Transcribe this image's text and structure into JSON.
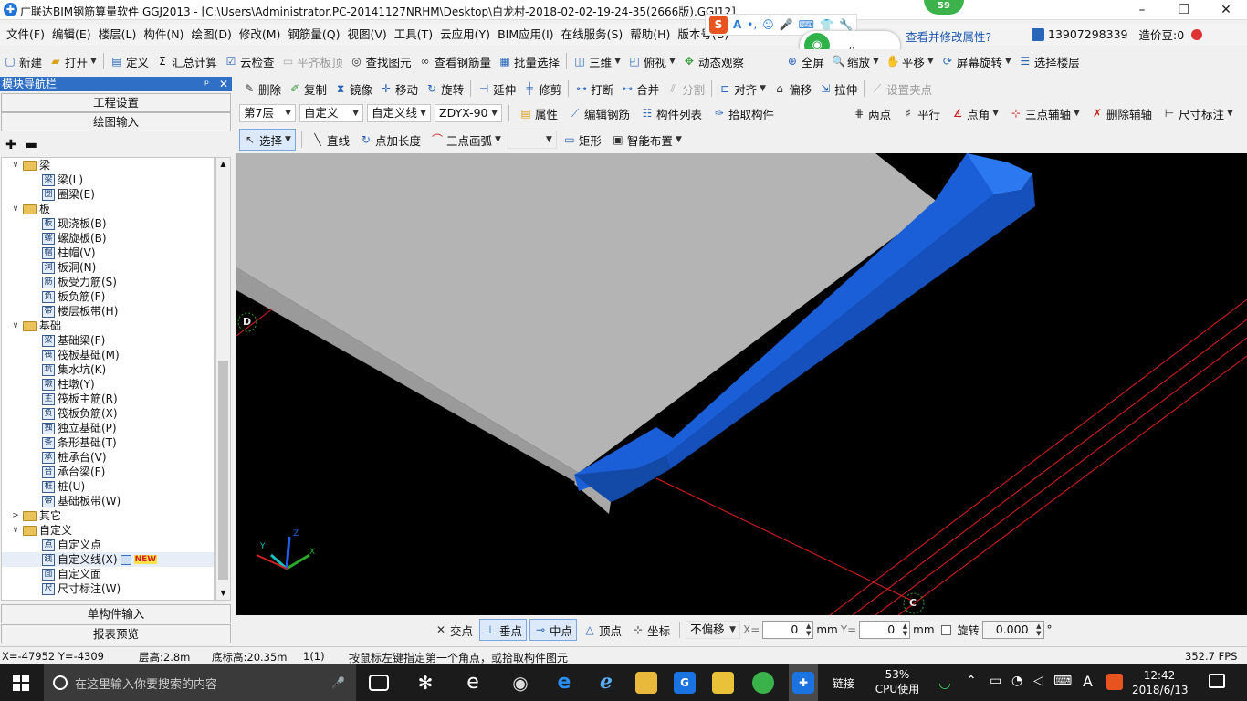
{
  "window": {
    "title": "广联达BIM钢筋算量软件 GGJ2013 - [C:\\Users\\Administrator.PC-20141127NRHM\\Desktop\\白龙村-2018-02-02-19-24-35(2666版).GGJ12]",
    "minimize": "–",
    "maximize": "❐",
    "close": "✕"
  },
  "menu": [
    "文件(F)",
    "编辑(E)",
    "楼层(L)",
    "构件(N)",
    "绘图(D)",
    "修改(M)",
    "钢筋量(Q)",
    "视图(V)",
    "工具(T)",
    "云应用(Y)",
    "BIM应用(I)",
    "在线服务(S)",
    "帮助(H)",
    "版本号(B)"
  ],
  "overlay": {
    "sogou": "S",
    "sogou_tools": [
      "A",
      "•,",
      "☺",
      "🎤",
      "⌨",
      "👕",
      "🔧"
    ],
    "wifi_badge": "59",
    "wifi_count": "0",
    "tip": "查看并修改属性?",
    "phone": "13907298339",
    "price_bean": "造价豆:0"
  },
  "toolbar1": {
    "new": "新建",
    "open": "打开",
    "define": "定义",
    "sum": "汇总计算",
    "cloud_check": "云检查",
    "flush_slab": "平齐板顶",
    "find": "查找图元",
    "view_rebar": "查看钢筋量",
    "batch_select": "批量选择",
    "view3d": "三维",
    "top_view": "俯视",
    "dynamic": "动态观察",
    "fullscreen": "全屏",
    "zoom": "缩放",
    "pan": "平移",
    "rotate_screen": "屏幕旋转",
    "select_floor": "选择楼层"
  },
  "toolbar2": {
    "delete": "删除",
    "copy": "复制",
    "mirror": "镜像",
    "move": "移动",
    "rotate": "旋转",
    "extend": "延伸",
    "trim": "修剪",
    "break": "打断",
    "merge": "合并",
    "split": "分割",
    "align": "对齐",
    "offset": "偏移",
    "stretch": "拉伸",
    "set_grip": "设置夹点"
  },
  "toolbar3": {
    "floor": "第7层",
    "category": "自定义",
    "type": "自定义线",
    "name": "ZDYX-90",
    "props": "属性",
    "edit_rebar": "编辑钢筋",
    "member_list": "构件列表",
    "pick": "拾取构件",
    "two_points": "两点",
    "parallel": "平行",
    "point_angle": "点角",
    "three_aux": "三点辅轴",
    "del_aux": "删除辅轴",
    "dim": "尺寸标注"
  },
  "toolbar4": {
    "select": "选择",
    "line": "直线",
    "point_len": "点加长度",
    "arc3": "三点画弧",
    "rect": "矩形",
    "smart": "智能布置"
  },
  "left": {
    "header": "模块导航栏",
    "pin": "ᵖ",
    "close": "✕",
    "project_settings": "工程设置",
    "drawing_input": "绘图输入",
    "single_input": "单构件输入",
    "report_preview": "报表预览",
    "tree": [
      {
        "kind": "cat",
        "label": "梁",
        "open": true
      },
      {
        "kind": "leaf",
        "label": "梁(L)",
        "icon": "梁"
      },
      {
        "kind": "leaf",
        "label": "圈梁(E)",
        "icon": "圈"
      },
      {
        "kind": "cat",
        "label": "板",
        "open": true
      },
      {
        "kind": "leaf",
        "label": "现浇板(B)",
        "icon": "板"
      },
      {
        "kind": "leaf",
        "label": "螺旋板(B)",
        "icon": "螺"
      },
      {
        "kind": "leaf",
        "label": "柱帽(V)",
        "icon": "帽"
      },
      {
        "kind": "leaf",
        "label": "板洞(N)",
        "icon": "洞"
      },
      {
        "kind": "leaf",
        "label": "板受力筋(S)",
        "icon": "筋"
      },
      {
        "kind": "leaf",
        "label": "板负筋(F)",
        "icon": "负"
      },
      {
        "kind": "leaf",
        "label": "楼层板带(H)",
        "icon": "带"
      },
      {
        "kind": "cat",
        "label": "基础",
        "open": true
      },
      {
        "kind": "leaf",
        "label": "基础梁(F)",
        "icon": "梁"
      },
      {
        "kind": "leaf",
        "label": "筏板基础(M)",
        "icon": "筏"
      },
      {
        "kind": "leaf",
        "label": "集水坑(K)",
        "icon": "坑"
      },
      {
        "kind": "leaf",
        "label": "柱墩(Y)",
        "icon": "墩"
      },
      {
        "kind": "leaf",
        "label": "筏板主筋(R)",
        "icon": "主"
      },
      {
        "kind": "leaf",
        "label": "筏板负筋(X)",
        "icon": "负"
      },
      {
        "kind": "leaf",
        "label": "独立基础(P)",
        "icon": "独"
      },
      {
        "kind": "leaf",
        "label": "条形基础(T)",
        "icon": "条"
      },
      {
        "kind": "leaf",
        "label": "桩承台(V)",
        "icon": "承"
      },
      {
        "kind": "leaf",
        "label": "承台梁(F)",
        "icon": "台"
      },
      {
        "kind": "leaf",
        "label": "桩(U)",
        "icon": "桩"
      },
      {
        "kind": "leaf",
        "label": "基础板带(W)",
        "icon": "带"
      },
      {
        "kind": "cat",
        "label": "其它",
        "open": false
      },
      {
        "kind": "cat",
        "label": "自定义",
        "open": true
      },
      {
        "kind": "leaf",
        "label": "自定义点",
        "icon": "点"
      },
      {
        "kind": "leaf",
        "label": "自定义线(X)",
        "icon": "线",
        "badge": "NEW",
        "selected": true
      },
      {
        "kind": "leaf",
        "label": "自定义面",
        "icon": "面"
      },
      {
        "kind": "leaf",
        "label": "尺寸标注(W)",
        "icon": "尺"
      }
    ]
  },
  "viewport": {
    "axis_d": "D",
    "axis_c": "C",
    "axis_x": "X",
    "axis_y": "Y",
    "axis_z": "Z"
  },
  "snap": {
    "intersection": "交点",
    "perpendicular": "垂点",
    "midpoint": "中点",
    "vertex": "顶点",
    "coord": "坐标",
    "offset_mode": "不偏移",
    "x_label": "X=",
    "x_value": "0",
    "mm1": "mm",
    "y_label": "Y=",
    "y_value": "0",
    "mm2": "mm",
    "rotate": "旋转",
    "rotate_value": "0.000",
    "degree": "°"
  },
  "status": {
    "coords": "X=-47952 Y=-4309",
    "floor_height": "层高:2.8m",
    "base_height": "底标高:20.35m",
    "count": "1(1)",
    "hint": "按鼠标左键指定第一个角点，或拾取构件图元",
    "fps": "352.7 FPS"
  },
  "taskbar": {
    "search_placeholder": "在这里输入你要搜索的内容",
    "link": "链接",
    "cpu": "53%",
    "cpu_label": "CPU使用",
    "ime": "A",
    "time": "12:42",
    "date": "2018/6/13"
  }
}
